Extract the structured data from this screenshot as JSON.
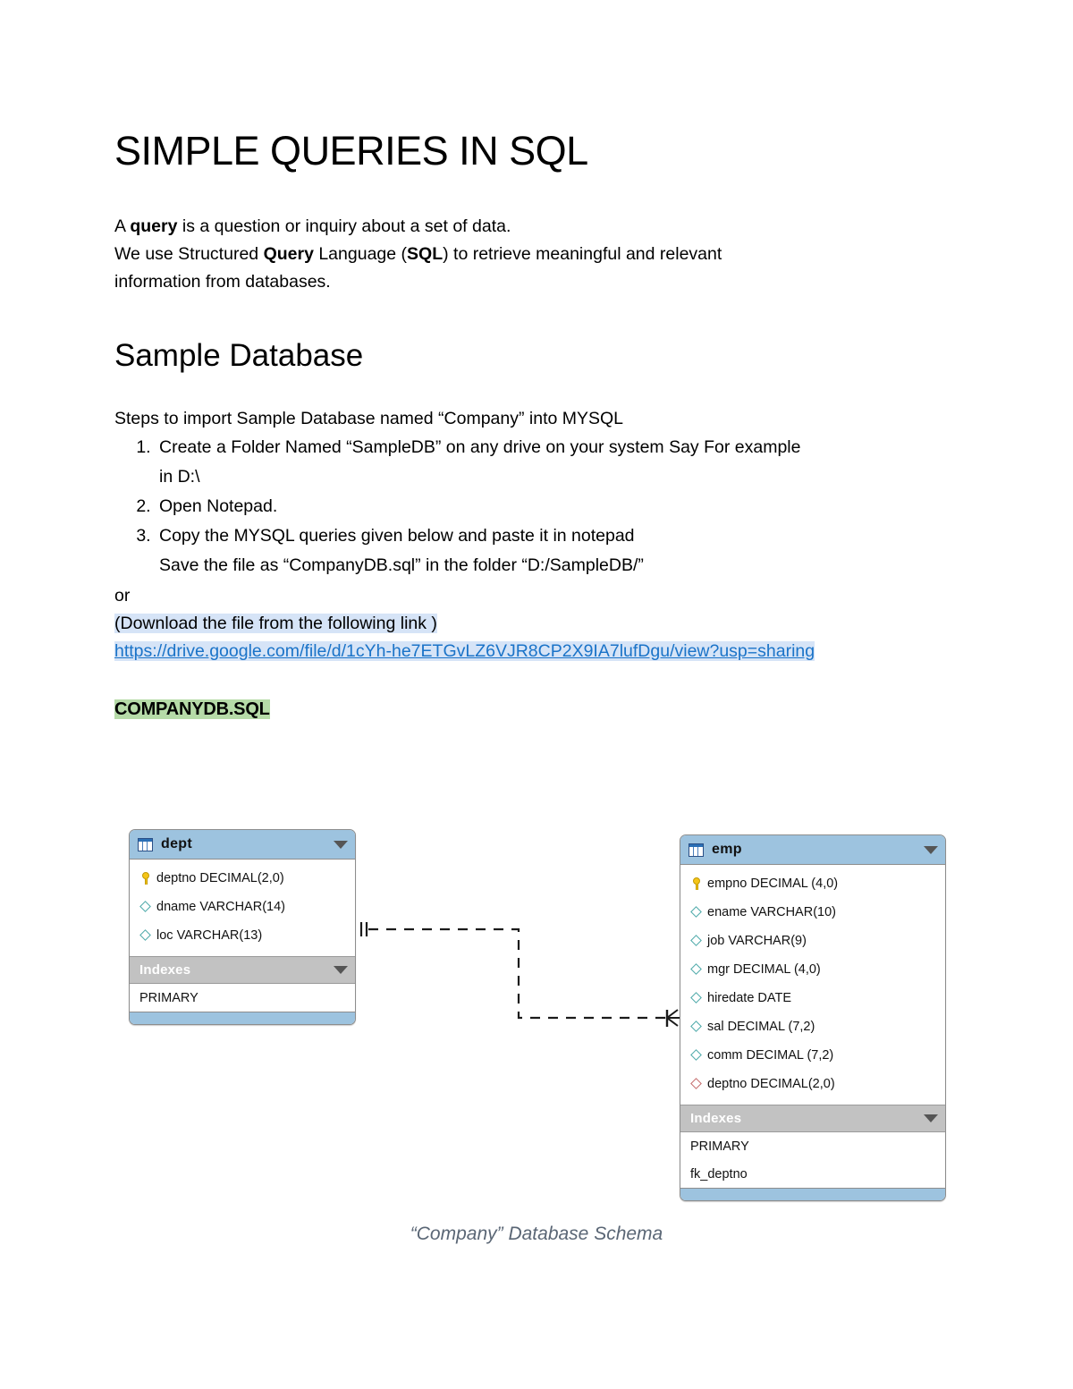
{
  "document": {
    "title": "SIMPLE QUERIES IN SQL",
    "intro": {
      "line1_prefix": "A ",
      "line1_bold": "query",
      "line1_suffix": " is a question or inquiry about a set of data.",
      "line2_a": "We use Structured ",
      "line2_bold1": "Query",
      "line2_b": " Language (",
      "line2_bold2": "SQL",
      "line2_c": ") to retrieve meaningful and relevant",
      "line3": "information from databases."
    },
    "section": {
      "heading": "Sample Database",
      "steps_intro": "Steps to import Sample Database named “Company” into MYSQL",
      "steps": [
        {
          "text": "Create a Folder Named “SampleDB” on any drive on your system Say For example",
          "sub": "in D:\\"
        },
        {
          "text": "Open Notepad.",
          "sub": ""
        },
        {
          "text": "Copy the MYSQL queries given below and paste it in notepad",
          "sub": "Save the file as “CompanyDB.sql” in the folder “D:/SampleDB/”"
        }
      ],
      "or_label": "or",
      "download_note": "(Download the file from the following link )",
      "download_url": "https://drive.google.com/file/d/1cYh-he7ETGvLZ6VJR8CP2X9IA7lufDgu/view?usp=sharing",
      "companydb_label": "COMPANYDB.SQL"
    },
    "figure_caption": "“Company” Database Schema"
  },
  "colors": {
    "table_header": "#9dc3df",
    "indexes_header": "#c2c2c2",
    "highlight_blue": "#d6e4f7",
    "highlight_green": "#b6dba8",
    "link_blue": "#1a73c8",
    "pk_key": "#f5c518",
    "column_diamond": "#4aa8a8",
    "fk_diamond": "#c46b6b",
    "caption_text": "#5a6675"
  },
  "schema": {
    "tables": [
      {
        "name": "dept",
        "icon": "table-icon",
        "collapse_icon": "chevron-down-icon",
        "fields": [
          {
            "icon": "primary-key-icon",
            "label": "deptno DECIMAL(2,0)",
            "kind": "pk"
          },
          {
            "icon": "column-icon",
            "label": "dname VARCHAR(14)",
            "kind": "col"
          },
          {
            "icon": "column-icon",
            "label": "loc VARCHAR(13)",
            "kind": "col"
          }
        ],
        "indexes_label": "Indexes",
        "indexes": [
          "PRIMARY"
        ]
      },
      {
        "name": "emp",
        "icon": "table-icon",
        "collapse_icon": "chevron-down-icon",
        "fields": [
          {
            "icon": "primary-key-icon",
            "label": "empno DECIMAL (4,0)",
            "kind": "pk"
          },
          {
            "icon": "column-icon",
            "label": "ename VARCHAR(10)",
            "kind": "col"
          },
          {
            "icon": "column-icon",
            "label": "job VARCHAR(9)",
            "kind": "col"
          },
          {
            "icon": "column-icon",
            "label": "mgr DECIMAL (4,0)",
            "kind": "col"
          },
          {
            "icon": "column-icon",
            "label": "hiredate DATE",
            "kind": "col"
          },
          {
            "icon": "column-icon",
            "label": "sal DECIMAL (7,2)",
            "kind": "col"
          },
          {
            "icon": "column-icon",
            "label": "comm  DECIMAL (7,2)",
            "kind": "col"
          },
          {
            "icon": "foreign-key-icon",
            "label": "deptno DECIMAL(2,0)",
            "kind": "fk"
          }
        ],
        "indexes_label": "Indexes",
        "indexes": [
          "PRIMARY",
          "fk_deptno"
        ]
      }
    ],
    "relationship": {
      "from": "dept",
      "to": "emp",
      "from_cardinality": "one",
      "to_cardinality": "many",
      "line_style": "dashed"
    }
  }
}
